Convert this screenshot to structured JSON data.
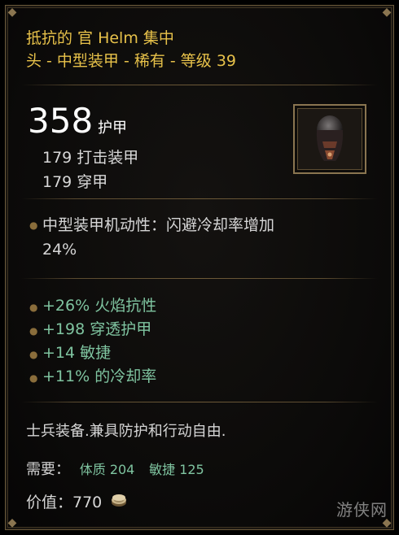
{
  "item": {
    "name": "抵抗的 官 Helm 集中",
    "type_line": "头 - 中型装甲 - 稀有 - 等级 39",
    "armor_value": "358",
    "armor_label": "护甲",
    "sub_stats": [
      "179 打击装甲",
      "179 穿甲"
    ],
    "property": "中型装甲机动性：闪避冷却率增加",
    "property_value": "24%",
    "affixes": [
      "+26% 火焰抗性",
      "+198 穿透护甲",
      "+14 敏捷",
      "+11% 的冷却率"
    ],
    "flavor": "士兵装备.兼具防护和行动自由.",
    "requirements_label": "需要：",
    "requirements": [
      "体质 204",
      "敏捷 125"
    ],
    "value_label": "价值：770",
    "icon": "helm-icon"
  },
  "watermark": "游侠网",
  "colors": {
    "title": "#e8c24a",
    "affix": "#7fc4a0",
    "border": "#8a7550"
  }
}
